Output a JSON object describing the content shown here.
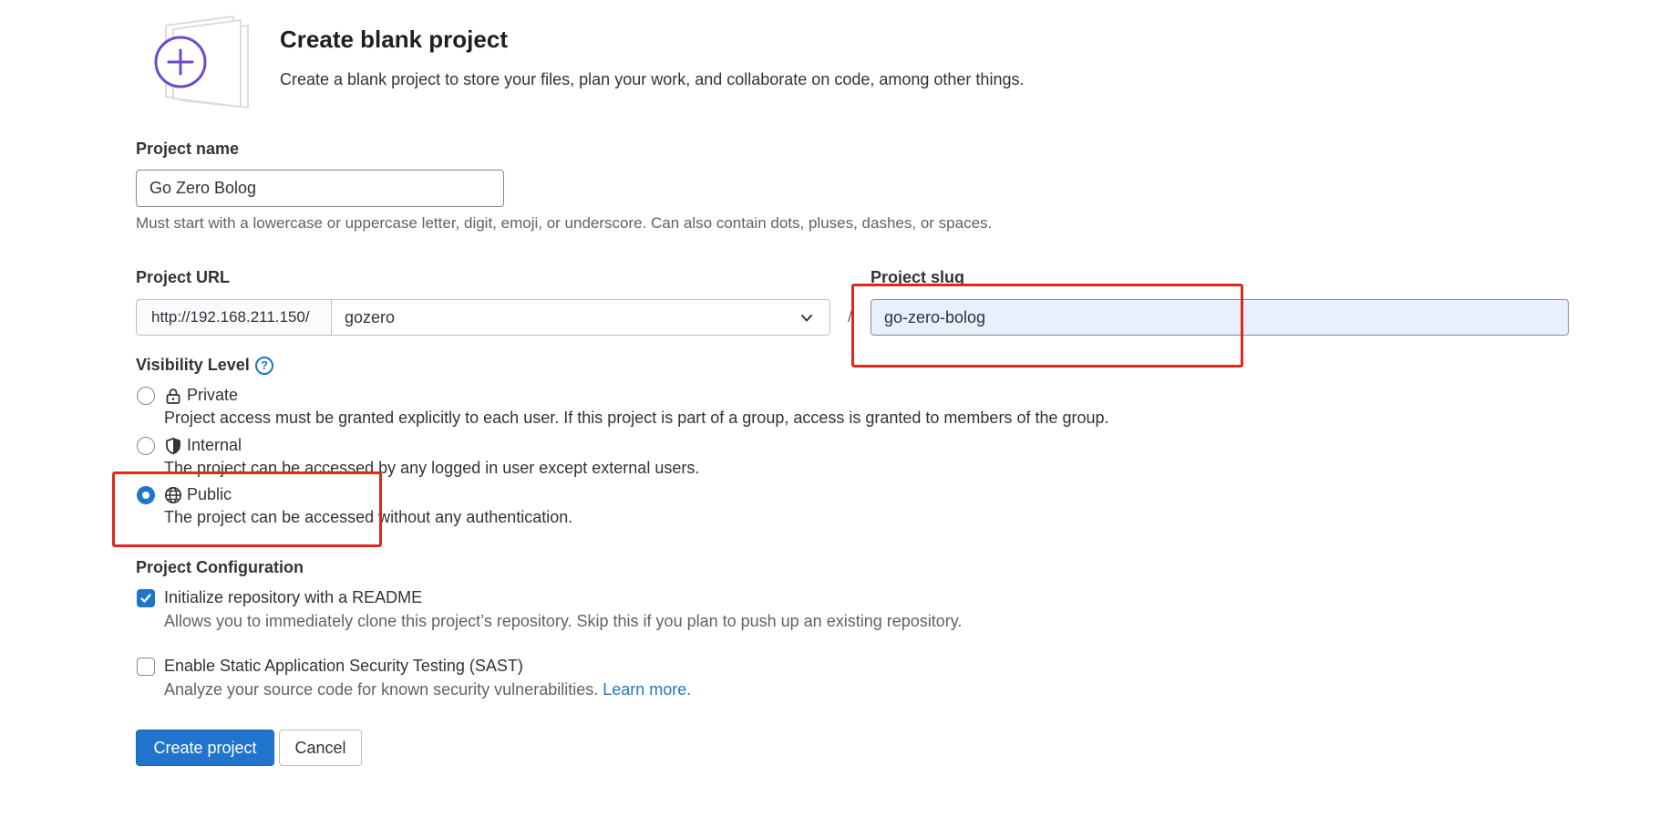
{
  "header": {
    "title": "Create blank project",
    "description": "Create a blank project to store your files, plan your work, and collaborate on code, among other things."
  },
  "project_name": {
    "label": "Project name",
    "value": "Go Zero Bolog",
    "help": "Must start with a lowercase or uppercase letter, digit, emoji, or underscore. Can also contain dots, pluses, dashes, or spaces."
  },
  "project_url": {
    "label": "Project URL",
    "prefix": "http://192.168.211.150/",
    "namespace": "gozero",
    "separator": "/"
  },
  "project_slug": {
    "label": "Project slug",
    "value": "go-zero-bolog"
  },
  "visibility": {
    "label": "Visibility Level",
    "help_icon": "?",
    "options": [
      {
        "label": "Private",
        "icon": "lock-icon",
        "checked": false,
        "help": "Project access must be granted explicitly to each user. If this project is part of a group, access is granted to members of the group."
      },
      {
        "label": "Internal",
        "icon": "shield-icon",
        "checked": false,
        "help": "The project can be accessed by any logged in user except external users."
      },
      {
        "label": "Public",
        "icon": "globe-icon",
        "checked": true,
        "help": "The project can be accessed without any authentication."
      }
    ]
  },
  "configuration": {
    "label": "Project Configuration",
    "readme": {
      "label": "Initialize repository with a README",
      "checked": true,
      "help": "Allows you to immediately clone this project’s repository. Skip this if you plan to push up an existing repository."
    },
    "sast": {
      "label": "Enable Static Application Security Testing (SAST)",
      "checked": false,
      "help": "Analyze your source code for known security vulnerabilities.",
      "link": "Learn more."
    }
  },
  "actions": {
    "create": "Create project",
    "cancel": "Cancel"
  },
  "colors": {
    "accent": "#1f75cb",
    "annotation": "#e0271d",
    "illustration_purple": "#6e49cb"
  }
}
